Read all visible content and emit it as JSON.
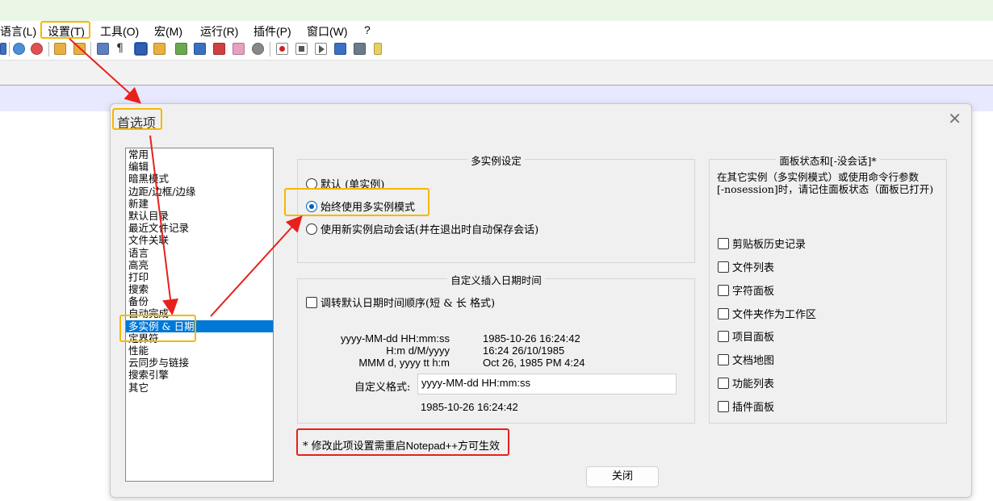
{
  "menu": {
    "items": [
      "语言(L)",
      "设置(T)",
      "工具(O)",
      "宏(M)",
      "运行(R)",
      "插件(P)",
      "窗口(W)",
      "?"
    ]
  },
  "toolbar": {
    "icons": [
      "open-icon",
      "zoom-in-icon",
      "zoom-out-icon",
      "sync-vertical-icon",
      "sync-horizontal-icon",
      "word-wrap-icon",
      "show-all-chars-icon",
      "indent-guide-icon",
      "language-udl-icon",
      "doc-map-icon",
      "doc-list-icon",
      "function-list-icon",
      "folder-workspace-icon",
      "monitor-icon",
      "record-macro-icon",
      "stop-macro-icon",
      "play-macro-icon",
      "run-macro-multi-icon",
      "save-macro-icon",
      "plugin-icon"
    ]
  },
  "dialog": {
    "title": "首选项",
    "close_glyph": "✕",
    "close_button": "关闭",
    "categories": [
      "常用",
      "编辑",
      "暗黑模式",
      "边距/边框/边缘",
      "新建",
      "默认目录",
      "最近文件记录",
      "文件关联",
      "语言",
      "高亮",
      "打印",
      "搜索",
      "备份",
      "自动完成",
      "多实例 & 日期",
      "定界符",
      "性能",
      "云同步与链接",
      "搜索引擎",
      "其它"
    ],
    "selected_category": "多实例 & 日期",
    "multi_instance": {
      "title": "多实例设定",
      "options": [
        {
          "label": "默认 (单实例)",
          "selected": false
        },
        {
          "label": "始终使用多实例模式",
          "selected": true
        },
        {
          "label": "使用新实例启动会话(并在退出时自动保存会话)",
          "selected": false
        }
      ]
    },
    "datetime": {
      "title": "自定义插入日期时间",
      "reverse_label": "调转默认日期时间顺序(短 & 长 格式)",
      "formats": [
        {
          "pattern": "yyyy-MM-dd HH:mm:ss",
          "example": "1985-10-26 16:24:42"
        },
        {
          "pattern": "H:m d/M/yyyy",
          "example": "16:24 26/10/1985"
        },
        {
          "pattern": "MMM d, yyyy  tt h:m",
          "example": "Oct 26, 1985  PM 4:24"
        }
      ],
      "custom_label": "自定义格式:",
      "custom_value": "yyyy-MM-dd HH:mm:ss",
      "preview": "1985-10-26 16:24:42"
    },
    "panel_state": {
      "title": "面板状态和[-没会话]*",
      "description_line1": "在其它实例（多实例模式）或使用命令行参数",
      "description_line2": "[-nosession]时，请记住面板状态（面板已打开)",
      "items": [
        "剪贴板历史记录",
        "文件列表",
        "字符面板",
        "文件夹作为工作区",
        "项目面板",
        "文档地图",
        "功能列表",
        "插件面板"
      ]
    },
    "notice_star": "* 修改此项设置需重启",
    "notice_app": "Notepad++",
    "notice_tail": "方可生效"
  },
  "colors": {
    "highlight": "#f5b800",
    "arrow": "#e8201c",
    "selection": "#0078d7",
    "radio": "#005fb8"
  }
}
